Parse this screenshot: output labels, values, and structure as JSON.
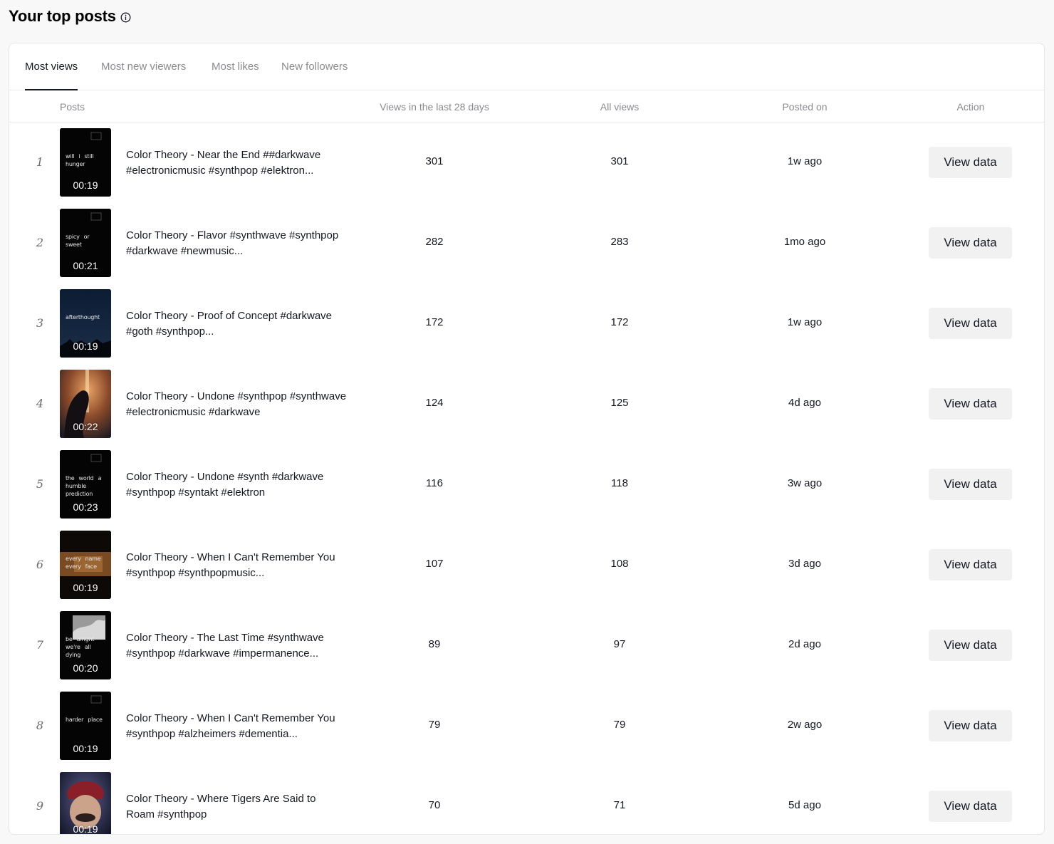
{
  "header": {
    "title": "Your top posts"
  },
  "tabs": [
    {
      "label": "Most views",
      "active": true
    },
    {
      "label": "Most new viewers",
      "active": false
    },
    {
      "label": "Most likes",
      "active": false
    },
    {
      "label": "New followers",
      "active": false
    }
  ],
  "columns": {
    "posts": "Posts",
    "views_28": "Views in the last 28 days",
    "all_views": "All views",
    "posted_on": "Posted on",
    "action": "Action"
  },
  "action_label": "View data",
  "rows": [
    {
      "rank": "1",
      "duration": "00:19",
      "caption": "Color Theory - Near the End ##darkwave #electronicmusic #synthpop #elektron...",
      "views_28": "301",
      "all_views": "301",
      "posted_on": "1w ago",
      "thumb_style": "dark-text"
    },
    {
      "rank": "2",
      "duration": "00:21",
      "caption": "Color Theory - Flavor #synthwave #synthpop #darkwave #newmusic...",
      "views_28": "282",
      "all_views": "283",
      "posted_on": "1mo ago",
      "thumb_style": "dark-text"
    },
    {
      "rank": "3",
      "duration": "00:19",
      "caption": "Color Theory - Proof of Concept #darkwave #goth #synthpop...",
      "views_28": "172",
      "all_views": "172",
      "posted_on": "1w ago",
      "thumb_style": "night-sky"
    },
    {
      "rank": "4",
      "duration": "00:22",
      "caption": "Color Theory - Undone #synthpop #synthwave #electronicmusic #darkwave",
      "views_28": "124",
      "all_views": "125",
      "posted_on": "4d ago",
      "thumb_style": "warm-city"
    },
    {
      "rank": "5",
      "duration": "00:23",
      "caption": "Color Theory - Undone #synth #darkwave #synthpop #syntakt #elektron",
      "views_28": "116",
      "all_views": "118",
      "posted_on": "3w ago",
      "thumb_style": "dark-text"
    },
    {
      "rank": "6",
      "duration": "00:19",
      "caption": "Color Theory - When I Can't Remember You #synthpop #synthpopmusic...",
      "views_28": "107",
      "all_views": "108",
      "posted_on": "3d ago",
      "thumb_style": "amber-text"
    },
    {
      "rank": "7",
      "duration": "00:20",
      "caption": "Color Theory - The Last Time #synthwave #synthpop #darkwave #impermanence...",
      "views_28": "89",
      "all_views": "97",
      "posted_on": "2d ago",
      "thumb_style": "gray-clouds"
    },
    {
      "rank": "8",
      "duration": "00:19",
      "caption": "Color Theory - When I Can't Remember You #synthpop #alzheimers #dementia...",
      "views_28": "79",
      "all_views": "79",
      "posted_on": "2w ago",
      "thumb_style": "dark-text"
    },
    {
      "rank": "9",
      "duration": "00:19",
      "caption": "Color Theory - Where Tigers Are Said to Roam #synthpop",
      "views_28": "70",
      "all_views": "71",
      "posted_on": "5d ago",
      "thumb_style": "face"
    }
  ],
  "thumb_words": {
    "1": [
      "will",
      "i",
      "still",
      "hunger"
    ],
    "2": [
      "spicy",
      "or",
      "sweet"
    ],
    "3": [
      "afterthought"
    ],
    "5": [
      "the",
      "world",
      "a",
      "humble",
      "prediction"
    ],
    "6": [
      "every",
      "name",
      "every",
      "face"
    ],
    "7": [
      "be",
      "alright",
      "we're",
      "all",
      "dying"
    ],
    "8": [
      "harder",
      "place"
    ]
  },
  "colors": {
    "text": "#161823",
    "muted": "#8a8b91",
    "button_bg": "#f1f1f2",
    "divider": "#ececec"
  },
  "icons": {
    "info": "info-icon"
  }
}
